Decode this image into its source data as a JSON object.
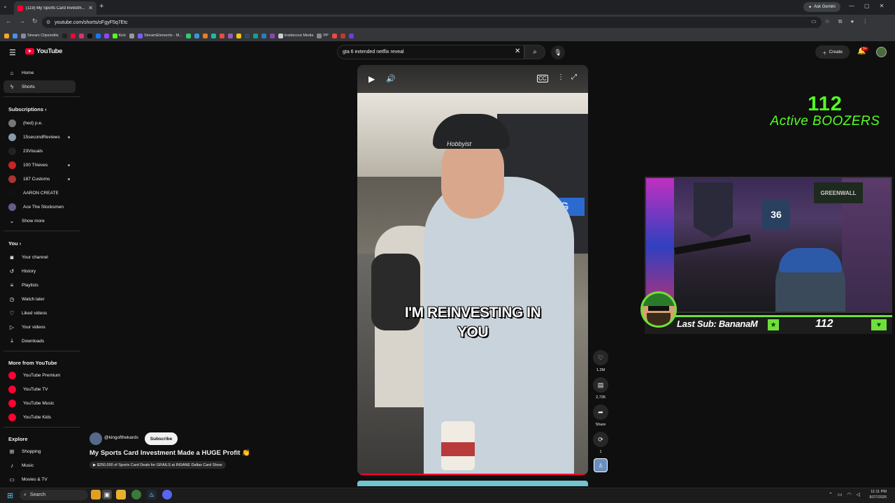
{
  "browser": {
    "tab_title": "(119) My Sports Card Investm...",
    "tab_close": "✕",
    "new_tab": "+",
    "tab_menu": "⌄",
    "ask_gemini": "Ask Gemini",
    "url": "youtube.com/shorts/oFgyF5q7Etc",
    "window_controls": [
      "—",
      "▢",
      "✕"
    ],
    "bookmarks": [
      {
        "label": "",
        "color": "#f5a623"
      },
      {
        "label": "",
        "color": "#4a90e2"
      },
      {
        "label": "Stream Clips/edits",
        "color": "#8888aa"
      },
      {
        "label": "",
        "color": "#222222"
      },
      {
        "label": "",
        "color": "#ff0033"
      },
      {
        "label": "",
        "color": "#e1306c"
      },
      {
        "label": "",
        "color": "#111111"
      },
      {
        "label": "",
        "color": "#1877f2"
      },
      {
        "label": "",
        "color": "#9146ff"
      },
      {
        "label": "Kick",
        "color": "#53fc18"
      },
      {
        "label": "",
        "color": "#999999"
      },
      {
        "label": "StreamElements - M...",
        "color": "#7a5cff"
      },
      {
        "label": "",
        "color": "#2ecc71"
      },
      {
        "label": "",
        "color": "#3498db"
      },
      {
        "label": "",
        "color": "#e67e22"
      },
      {
        "label": "",
        "color": "#1abc9c"
      },
      {
        "label": "",
        "color": "#e74c3c"
      },
      {
        "label": "",
        "color": "#9b59b6"
      },
      {
        "label": "",
        "color": "#f1c40f"
      },
      {
        "label": "",
        "color": "#34495e"
      },
      {
        "label": "",
        "color": "#16a085"
      },
      {
        "label": "",
        "color": "#2980b9"
      },
      {
        "label": "",
        "color": "#8e44ad"
      },
      {
        "label": "Insidecout Media",
        "color": "#cccccc"
      },
      {
        "label": "PP",
        "color": "#888888"
      },
      {
        "label": "",
        "color": "#e74c3c"
      },
      {
        "label": "",
        "color": "#c0392b"
      },
      {
        "label": "",
        "color": "#6c3ce0"
      }
    ]
  },
  "header": {
    "logo_text": "YouTube",
    "search_value": "gta 6 extended netflix reveal",
    "create_label": "Create",
    "notification_badge": "9+"
  },
  "sidebar": {
    "main": [
      {
        "label": "Home",
        "icon": "⌂"
      },
      {
        "label": "Shorts",
        "icon": "ϟ"
      }
    ],
    "subscriptions_title": "Subscriptions",
    "subscriptions": [
      {
        "label": "(hed) p.e.",
        "color": "#777777",
        "dot": false
      },
      {
        "label": "15secondReviews",
        "color": "#8899aa",
        "dot": true
      },
      {
        "label": "23Visuals",
        "color": "#222222",
        "dot": false
      },
      {
        "label": "100 Thieves",
        "color": "#cc2222",
        "dot": true
      },
      {
        "label": "187 Customs",
        "color": "#aa3333",
        "dot": true
      },
      {
        "label": "AARON CREATE",
        "color": "#111111",
        "dot": false
      },
      {
        "label": "Ace The Stocksmen",
        "color": "#6a5a8a",
        "dot": false
      }
    ],
    "show_more": "Show more",
    "you_title": "You",
    "you": [
      {
        "label": "Your channel",
        "icon": "◙"
      },
      {
        "label": "History",
        "icon": "↺"
      },
      {
        "label": "Playlists",
        "icon": "≡"
      },
      {
        "label": "Watch later",
        "icon": "◷"
      },
      {
        "label": "Liked videos",
        "icon": "♡"
      },
      {
        "label": "Your videos",
        "icon": "▷"
      },
      {
        "label": "Downloads",
        "icon": "⤓"
      }
    ],
    "more_title": "More from YouTube",
    "more": [
      {
        "label": "YouTube Premium",
        "color": "#ff0033"
      },
      {
        "label": "YouTube TV",
        "color": "#ff0033"
      },
      {
        "label": "YouTube Music",
        "color": "#ff0033"
      },
      {
        "label": "YouTube Kids",
        "color": "#ff0033"
      }
    ],
    "explore_title": "Explore",
    "explore": [
      {
        "label": "Shopping",
        "icon": "⊞"
      },
      {
        "label": "Music",
        "icon": "♪"
      },
      {
        "label": "Movies & TV",
        "icon": "▭"
      }
    ]
  },
  "video": {
    "caption": "I'M REINVESTING IN YOU",
    "cap_text": "Hobbyist",
    "banner_text": "BUYING",
    "progress_fraction": 1.0
  },
  "actions": {
    "likes": "1.2M",
    "comments": "2,735",
    "share": "Share",
    "remix": "1"
  },
  "info": {
    "channel": "@kingofthekards",
    "subscribe": "Subscribe",
    "title": "My Sports Card Investment Made a HUGE Profit",
    "title_emoji": "👏",
    "link": "▶ $250,000 of Sports Card Deals for GRAILS at INSANE Dallas Card Show"
  },
  "overlay": {
    "viewer_count": "112",
    "viewer_label": "Active BOOZERS",
    "last_sub": "Last Sub: BananaM",
    "sub_count": "112",
    "cam_jersey": "36",
    "cam_banner": "GREENWALL"
  },
  "taskbar": {
    "search": "Search",
    "clock_time": "11:11 PM",
    "clock_date": "8/27/2026"
  }
}
